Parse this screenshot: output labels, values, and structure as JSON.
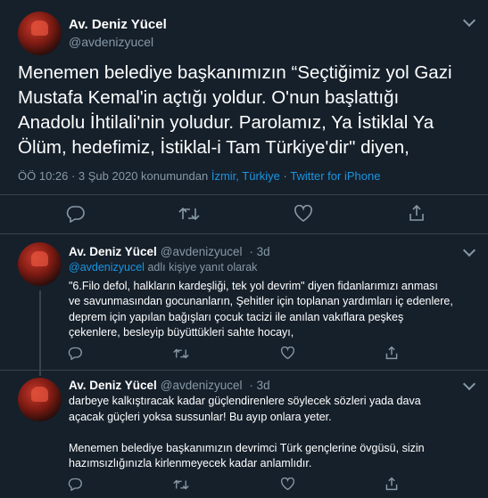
{
  "main_tweet": {
    "author_name": "Av. Deniz Yücel",
    "author_handle": "@avdenizyucel",
    "text_lines": [
      "Menemen belediye başkanımızın “Seçtiğimiz yol Gazi",
      "Mustafa Kemal'in açtığı yoldur. O'nun başlattığı",
      "Anadolu İhtilali'nin yoludur. Parolamız, Ya İstiklal Ya",
      "Ölüm, hedefimiz, İstiklal-i Tam Türkiye'dir\" diyen,"
    ],
    "timestamp": "ÖÖ 10:26 · 3 Şub 2020 konumundan",
    "location": "İzmir, Türkiye",
    "separator": "·",
    "source": "Twitter for iPhone"
  },
  "replies": [
    {
      "author_name": "Av. Deniz Yücel",
      "author_handle": "@avdenizyucel",
      "age": "· 3d",
      "replying_handle": "@avdenizyucel",
      "replying_suffix": "adlı kişiye yanıt olarak",
      "text_lines": [
        "\"6.Filo defol, halkların kardeşliği, tek yol devrim\" diyen fidanlarımızı anması",
        "ve savunmasından gocunanların, Şehitler için toplanan yardımları iç edenlere,",
        "deprem için yapılan bağışları çocuk tacizi ile anılan vakıflara peşkeş",
        "çekenlere, besleyip büyüttükleri sahte hocayı,"
      ]
    },
    {
      "author_name": "Av. Deniz Yücel",
      "author_handle": "@avdenizyucel",
      "age": "· 3d",
      "text_lines": [
        "darbeye kalkıştıracak kadar güçlendirenlere söylecek sözleri yada dava",
        "açacak güçleri yoksa sussunlar! Bu ayıp onlara yeter.",
        "",
        "Menemen belediye başkanımızın devrimci Türk gençlerine övgüsü, sizin",
        "hazımsızlığınızla kirlenmeyecek kadar anlamlıdır."
      ]
    }
  ],
  "icons": [
    "reply-icon",
    "retweet-icon",
    "like-icon",
    "share-icon",
    "chevron-down-icon"
  ],
  "colors": {
    "background": "#15202b",
    "text": "#ffffff",
    "muted": "#8899a6",
    "link": "#1b95e0",
    "divider": "#38444d"
  }
}
